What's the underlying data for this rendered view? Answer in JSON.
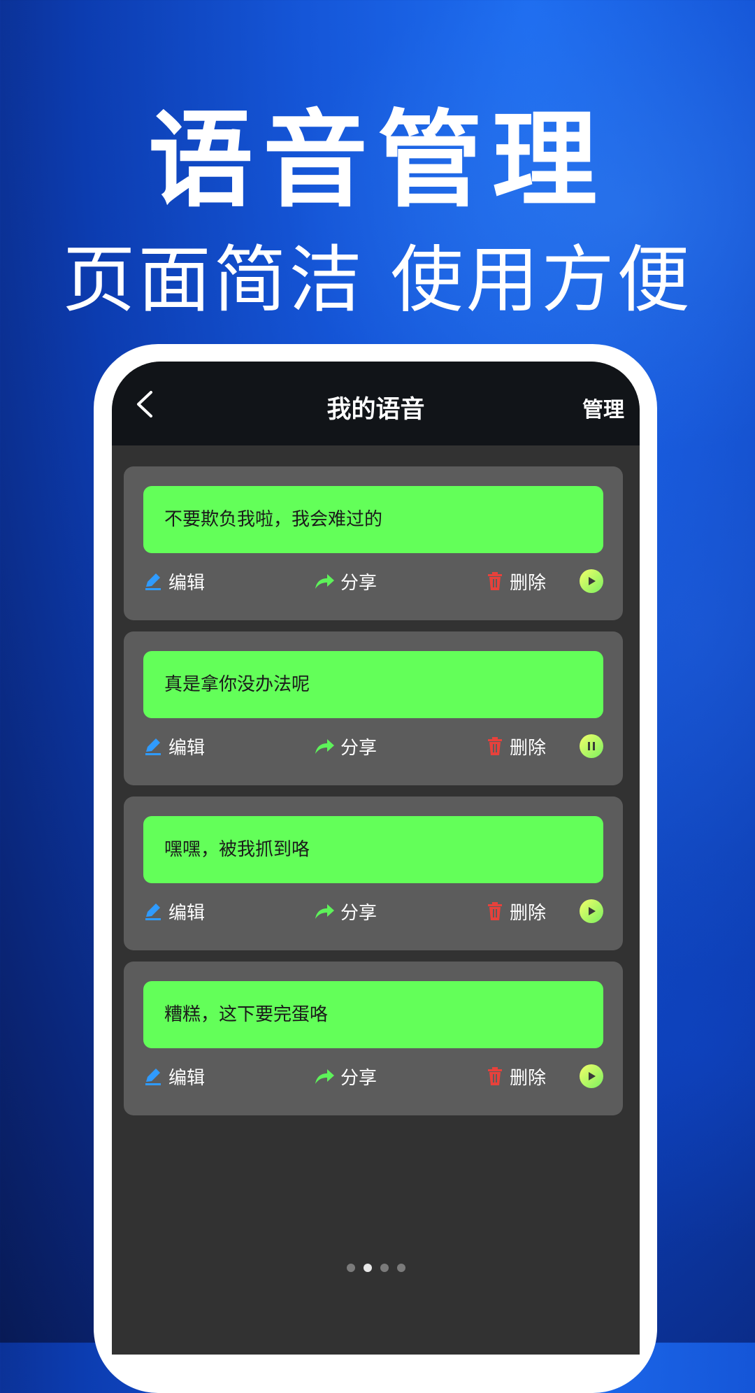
{
  "promo": {
    "headline": "语音管理",
    "subline": "页面简洁 使用方便"
  },
  "screen": {
    "title": "我的语音",
    "manage_label": "管理",
    "items": [
      {
        "text": "不要欺负我啦，我会难过的",
        "state": "play"
      },
      {
        "text": "真是拿你没办法呢",
        "state": "pause"
      },
      {
        "text": "嘿嘿，被我抓到咯",
        "state": "play"
      },
      {
        "text": "糟糕，这下要完蛋咯",
        "state": "play"
      }
    ],
    "actions": {
      "edit": "编辑",
      "share": "分享",
      "delete": "删除"
    }
  },
  "pager": {
    "count": 4,
    "active_index": 1
  },
  "colors": {
    "bubble": "#63ff59",
    "card": "#5c5c5c",
    "screen_bg": "#323232",
    "edit_icon": "#2f9bff",
    "share_icon": "#5ef25a",
    "delete_icon": "#e8413b"
  }
}
